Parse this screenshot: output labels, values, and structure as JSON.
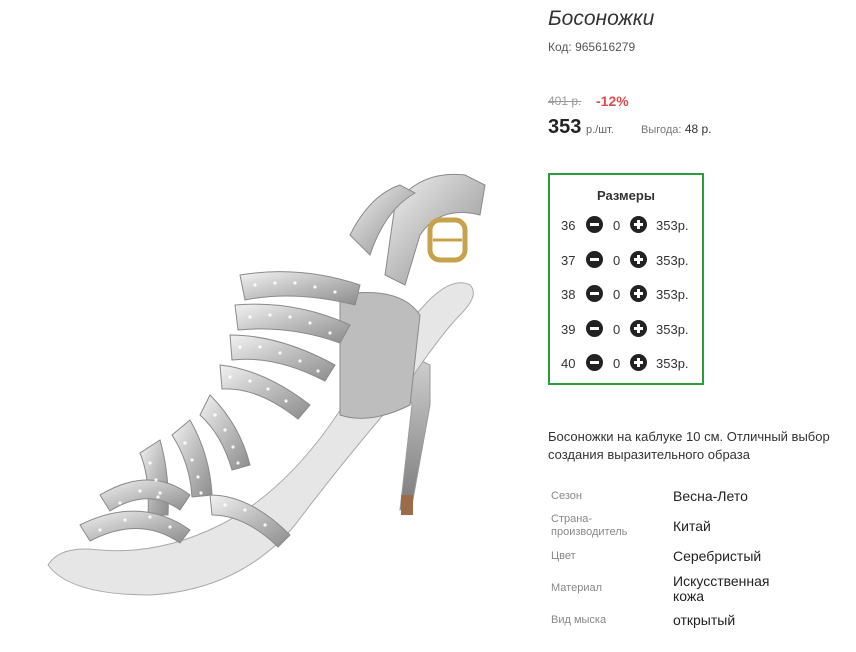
{
  "product": {
    "title": "Босоножки",
    "code": "Код: 965616279",
    "old_price": "401 р.",
    "discount": "-12%",
    "price": "353",
    "unit": "р./шт.",
    "saving_label": "Выгода:",
    "saving_value": "48 р.",
    "image_icon": "silver-heeled-sandal"
  },
  "sizes": {
    "title": "Размеры",
    "rows": [
      {
        "size": "36",
        "qty": "0",
        "price": "353р."
      },
      {
        "size": "37",
        "qty": "0",
        "price": "353р."
      },
      {
        "size": "38",
        "qty": "0",
        "price": "353р."
      },
      {
        "size": "39",
        "qty": "0",
        "price": "353р."
      },
      {
        "size": "40",
        "qty": "0",
        "price": "353р."
      }
    ]
  },
  "description": "Босоножки на каблуке 10 см. Отличный выбор создания выразительного образа",
  "properties": [
    {
      "label": "Сезон",
      "value": "Весна-Лето"
    },
    {
      "label": "Страна-производитель",
      "value": "Китай"
    },
    {
      "label": "Цвет",
      "value": "Серебристый"
    },
    {
      "label": "Материал",
      "value": "Искусственная кожа"
    },
    {
      "label": "Вид мыска",
      "value": "открытый"
    }
  ],
  "colors": {
    "accent_border": "#2a9c3a",
    "discount": "#e5494e"
  }
}
